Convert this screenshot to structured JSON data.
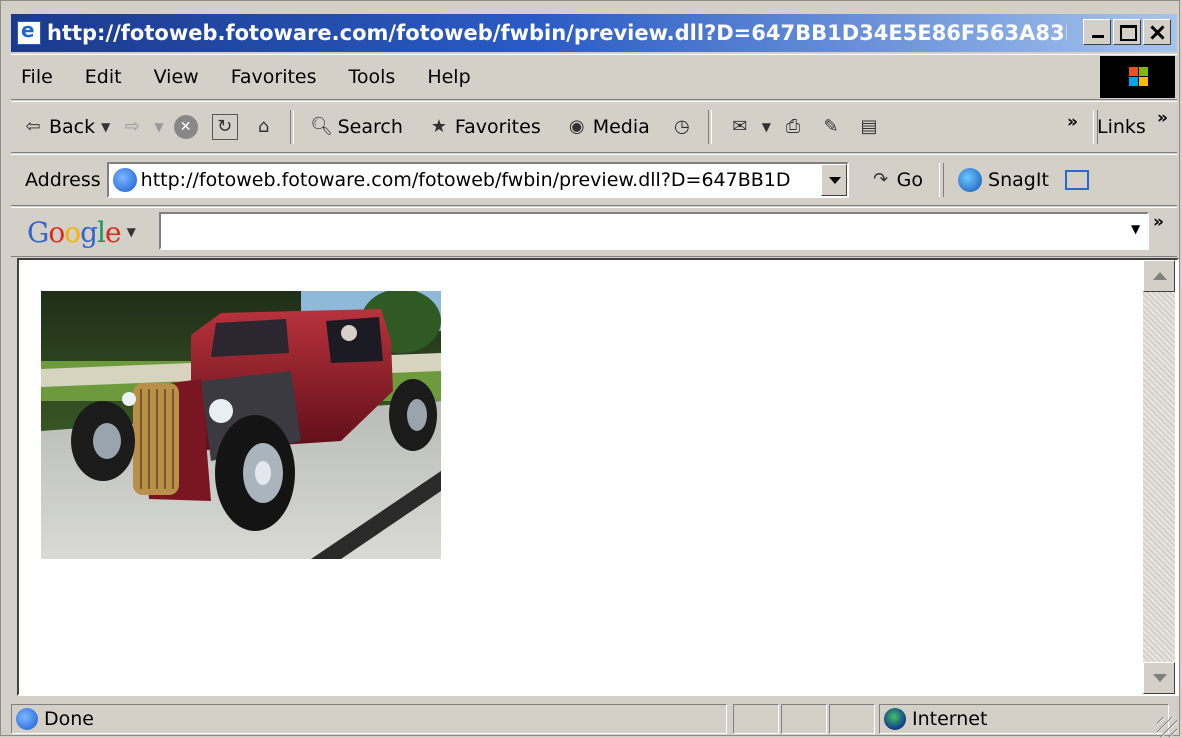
{
  "window": {
    "title": "http://fotoweb.fotoware.com/fotoweb/fwbin/preview.dll?D=647BB1D34E5E86F563A83F..."
  },
  "menu": {
    "items": [
      "File",
      "Edit",
      "View",
      "Favorites",
      "Tools",
      "Help"
    ]
  },
  "toolbar": {
    "back": "Back",
    "search": "Search",
    "favorites": "Favorites",
    "media": "Media",
    "links": "Links",
    "chevron": "»"
  },
  "address": {
    "label": "Address",
    "value": "http://fotoweb.fotoware.com/fotoweb/fwbin/preview.dll?D=647BB1D",
    "go": "Go",
    "snagit": "SnagIt"
  },
  "google": {
    "brand": [
      "G",
      "o",
      "o",
      "g",
      "l",
      "e"
    ],
    "value": ""
  },
  "status": {
    "text": "Done",
    "zone": "Internet"
  },
  "colors": {
    "titlebar_start": "#1b3a8c",
    "titlebar_end": "#a6c4ec",
    "chrome": "#d4d0c8"
  }
}
